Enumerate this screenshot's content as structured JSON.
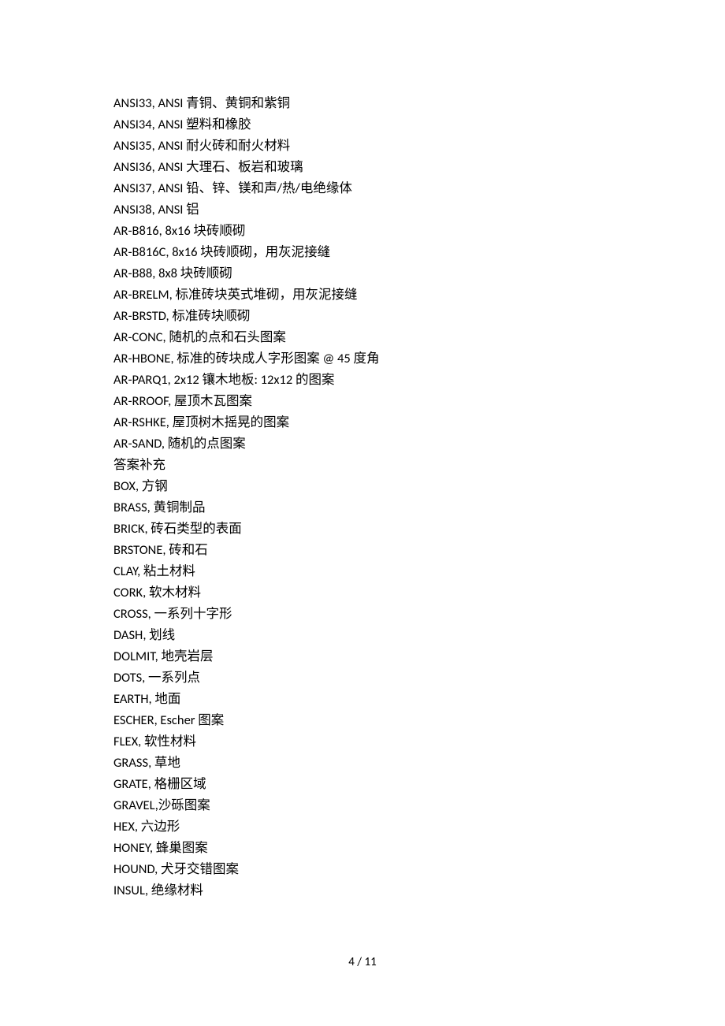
{
  "lines": [
    "ANSI33, ANSI 青铜、黄铜和紫铜",
    "ANSI34, ANSI 塑料和橡胶",
    "ANSI35, ANSI 耐火砖和耐火材料",
    "ANSI36, ANSI 大理石、板岩和玻璃",
    "ANSI37, ANSI 铅、锌、镁和声/热/电绝缘体",
    "ANSI38, ANSI 铝",
    "AR-B816, 8x16 块砖顺砌",
    "AR-B816C, 8x16 块砖顺砌，用灰泥接缝",
    "AR-B88, 8x8 块砖顺砌",
    "AR-BRELM, 标准砖块英式堆砌，用灰泥接缝",
    "AR-BRSTD, 标准砖块顺砌",
    "AR-CONC, 随机的点和石头图案",
    "AR-HBONE, 标准的砖块成人字形图案 @ 45 度角",
    "AR-PARQ1, 2x12 镶木地板: 12x12 的图案",
    "AR-RROOF, 屋顶木瓦图案",
    "AR-RSHKE, 屋顶树木摇晃的图案",
    "AR-SAND, 随机的点图案",
    "答案补充",
    "BOX, 方钢",
    "BRASS, 黄铜制品",
    "BRICK, 砖石类型的表面",
    "BRSTONE, 砖和石",
    "CLAY, 粘土材料",
    "CORK, 软木材料",
    "CROSS, 一系列十字形",
    "DASH, 划线",
    "DOLMIT, 地壳岩层",
    "DOTS, 一系列点",
    "EARTH, 地面",
    "ESCHER, Escher 图案",
    "FLEX, 软性材料",
    "GRASS, 草地",
    "GRATE, 格栅区域",
    "GRAVEL,沙砾图案",
    "HEX, 六边形",
    "HONEY, 蜂巢图案",
    "HOUND, 犬牙交错图案",
    "INSUL, 绝缘材料"
  ],
  "footer": "4 / 11"
}
